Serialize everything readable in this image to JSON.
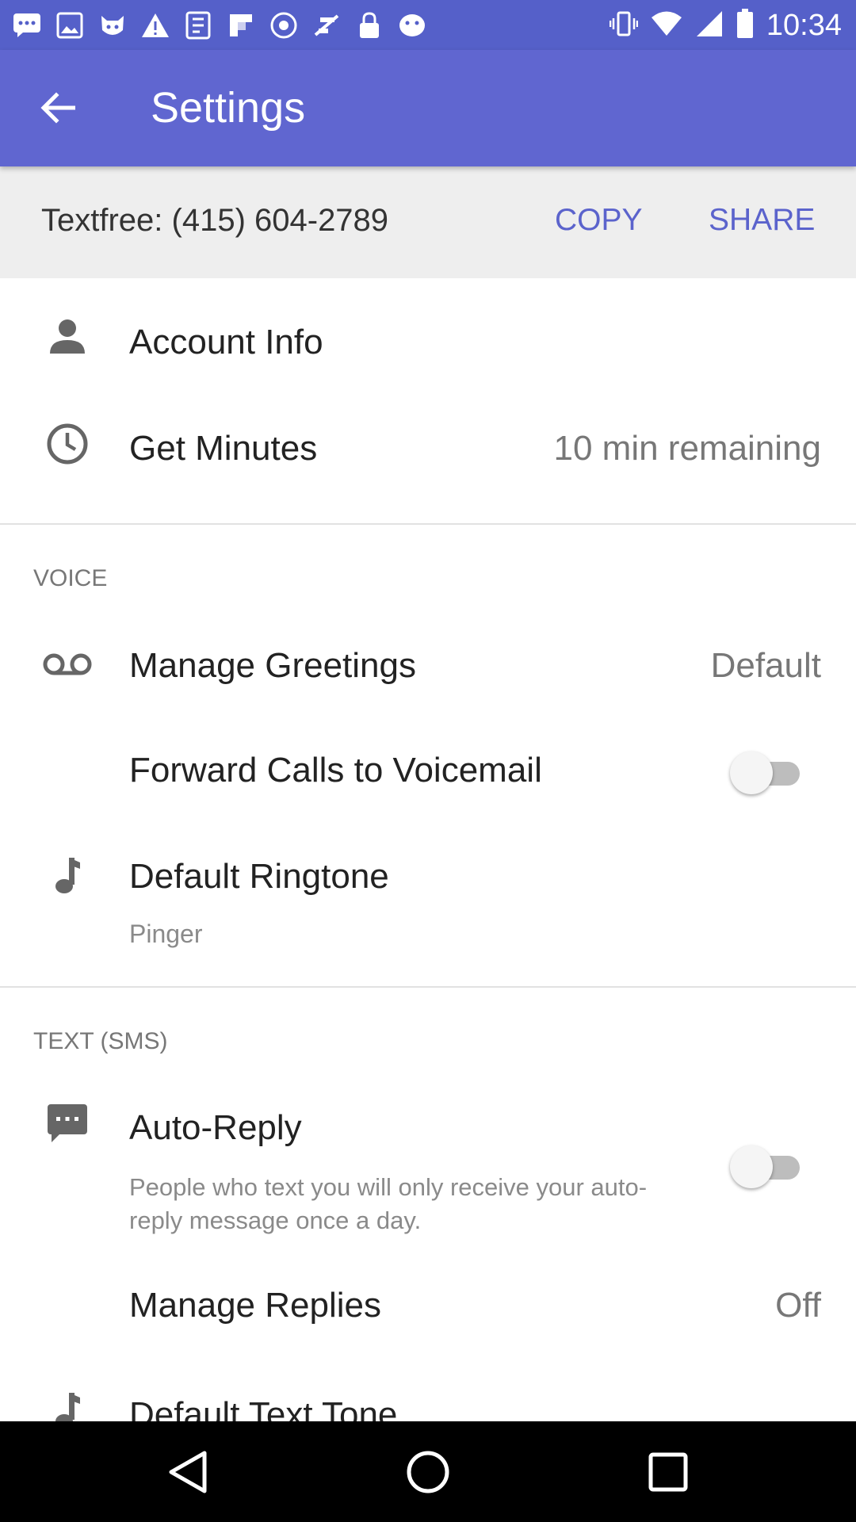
{
  "status_bar": {
    "time": "10:34",
    "icons": [
      "chat-bubble-icon",
      "image-icon",
      "cat-face-icon",
      "warning-icon",
      "app-icon",
      "flipboard-icon",
      "shazam-icon",
      "fake-gps-icon",
      "lock-icon",
      "emoji-icon",
      "vibrate-icon",
      "wifi-icon",
      "signal-icon",
      "battery-icon"
    ]
  },
  "app_bar": {
    "title": "Settings"
  },
  "number_row": {
    "number_label": "Textfree: (415) 604-2789",
    "copy_label": "COPY",
    "share_label": "SHARE"
  },
  "account": {
    "account_info_label": "Account Info",
    "get_minutes_label": "Get Minutes",
    "get_minutes_value": "10 min remaining"
  },
  "voice": {
    "section_label": "VOICE",
    "manage_greetings_label": "Manage Greetings",
    "manage_greetings_value": "Default",
    "forward_calls_label": "Forward Calls to Voicemail",
    "forward_calls_on": false,
    "default_ringtone_label": "Default Ringtone",
    "default_ringtone_value": "Pinger"
  },
  "text_sms": {
    "section_label": "TEXT (SMS)",
    "auto_reply_label": "Auto-Reply",
    "auto_reply_desc_line1": "People who text you will only receive your auto-",
    "auto_reply_desc_line2": "reply message once a day.",
    "auto_reply_on": false,
    "manage_replies_label": "Manage Replies",
    "manage_replies_value": "Off",
    "default_text_tone_label": "Default Text Tone"
  },
  "colors": {
    "app_bar": "#6066d0",
    "status_bar": "#5560c9",
    "accent": "#5b63cc"
  }
}
